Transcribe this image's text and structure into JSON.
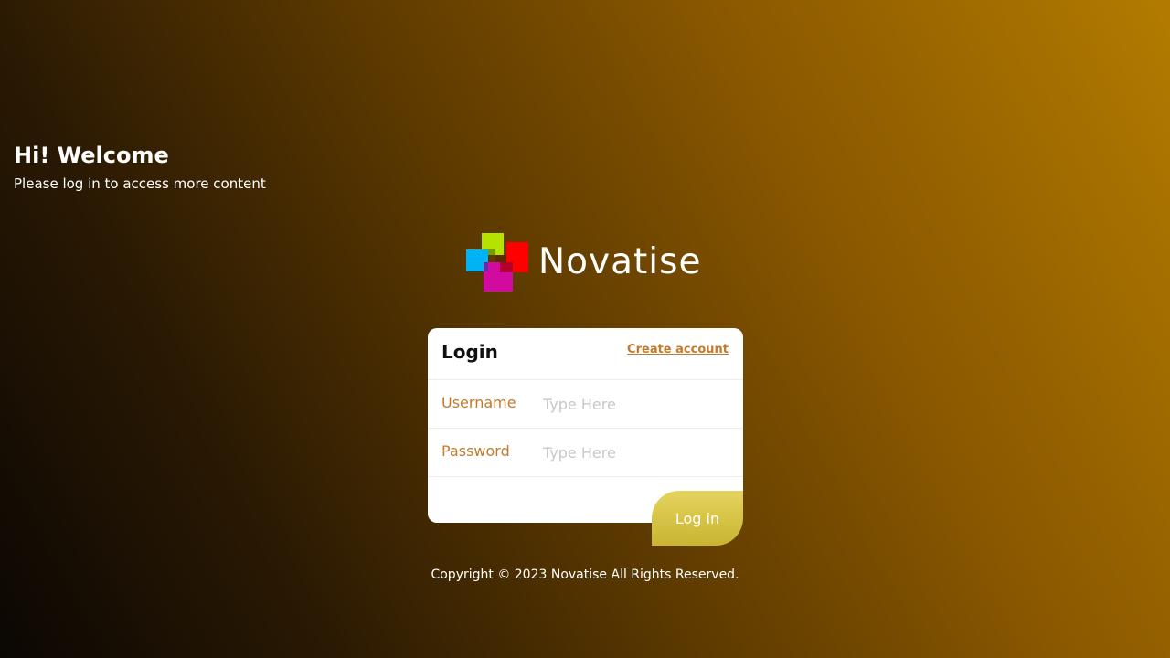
{
  "welcome": {
    "title": "Hi! Welcome",
    "subtitle": "Please log in to access more content"
  },
  "brand": {
    "name": "Novatise",
    "logo_icon": "four-color-squares-logo",
    "logo_colors": [
      "#b5e300",
      "#ff0000",
      "#00b3f5",
      "#d10aa0"
    ]
  },
  "login_card": {
    "title": "Login",
    "create_account_label": "Create account",
    "username_label": "Username",
    "username_placeholder": "Type Here",
    "username_value": "",
    "password_label": "Password",
    "password_placeholder": "Type Here",
    "password_value": "",
    "login_button_label": "Log in"
  },
  "footer": {
    "copyright": "Copyright © 2023 Novatise All Rights Reserved."
  },
  "colors": {
    "accent": "#c27a2d",
    "button_top": "#e4d35e",
    "button_bottom": "#c9b531"
  }
}
